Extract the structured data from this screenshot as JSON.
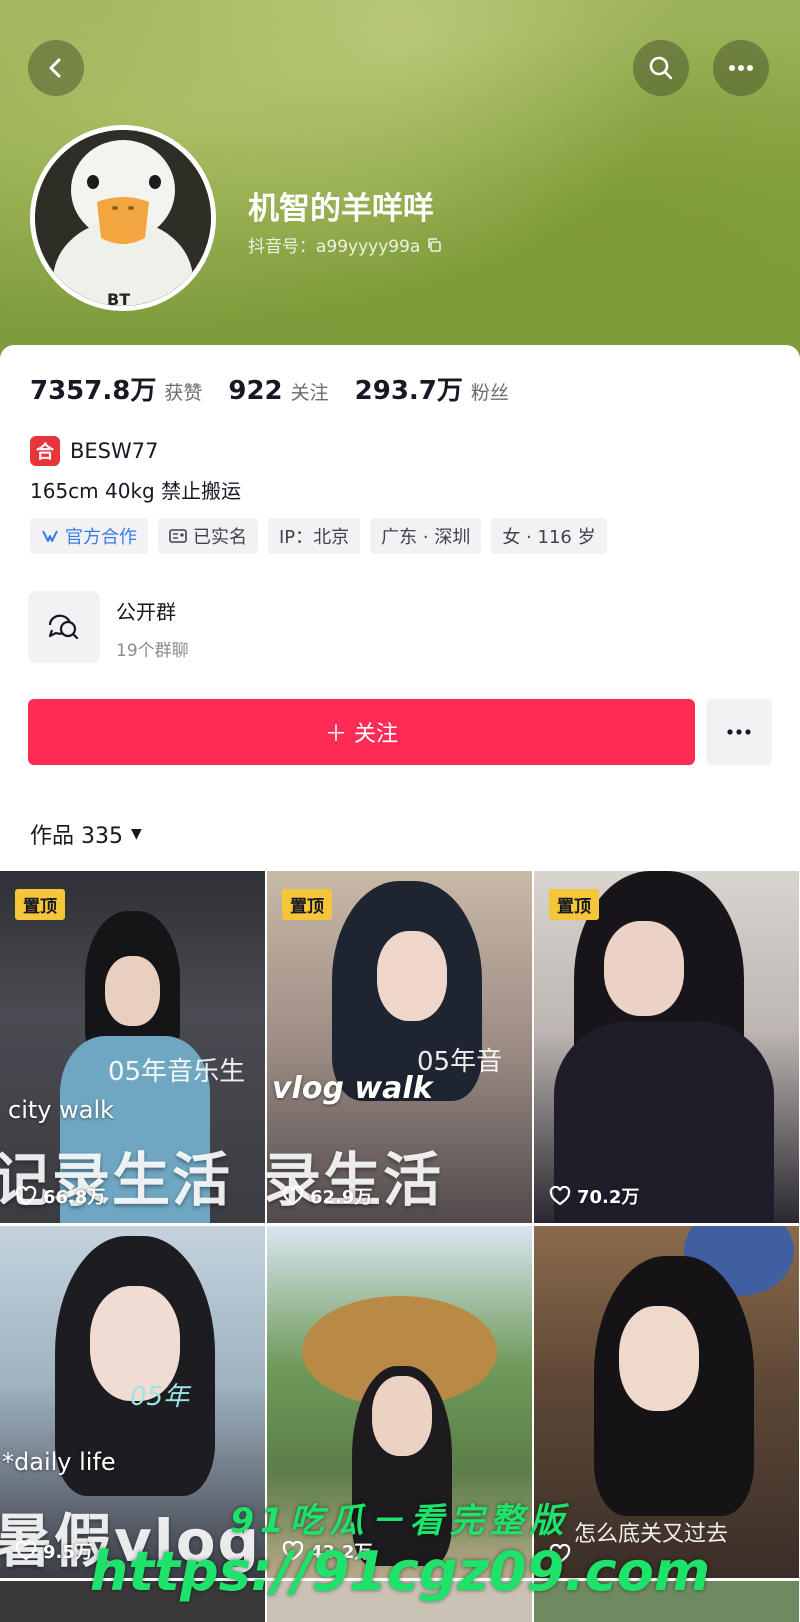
{
  "profile": {
    "nickname": "机智的羊咩咩",
    "douyin_id": "抖音号：a99yyyy99a",
    "avatar_tag": "BT"
  },
  "stats": [
    {
      "value": "7357.8万",
      "label": "获赞"
    },
    {
      "value": "922",
      "label": "关注"
    },
    {
      "value": "293.7万",
      "label": "粉丝"
    }
  ],
  "brand": {
    "badge": "合",
    "text": "BESW77"
  },
  "bio": "165cm 40kg 禁止搬运",
  "tags": [
    "官方合作",
    "已实名",
    "IP：北京",
    "广东 · 深圳",
    "女 · 116 岁"
  ],
  "group": {
    "title": "公开群",
    "subtitle": "19个群聊"
  },
  "actions": {
    "follow_label": "＋ 关注",
    "more_label": "···"
  },
  "works": {
    "label": "作品 335",
    "caret": "▼"
  },
  "videos": [
    {
      "pinned": "置顶",
      "likes": "66.8万",
      "overlay_big": "记录生活",
      "overlay_small": "city walk",
      "overlay_cn": "05年音乐生"
    },
    {
      "pinned": "置顶",
      "likes": "62.9万",
      "overlay_big": "录生活",
      "overlay_small": "vlog walk",
      "overlay_cn": "05年音"
    },
    {
      "pinned": "置顶",
      "likes": "70.2万"
    },
    {
      "likes": "9.5万",
      "overlay_big": "暑假vlog",
      "overlay_small": "*daily life",
      "overlay_cn": "05年"
    },
    {
      "likes": "43.2万"
    },
    {
      "likes": "",
      "overlay_cn": "怎么底关又过去"
    }
  ],
  "watermark": {
    "line1": "91吃瓜－看完整版",
    "line2": "https://91cgz09.com"
  },
  "colors": {
    "follow": "#fe2c55",
    "pin": "#f5c53a",
    "official": "#3b7be8",
    "watermark": "#1de36b",
    "brand_badge": "#e8343b"
  }
}
